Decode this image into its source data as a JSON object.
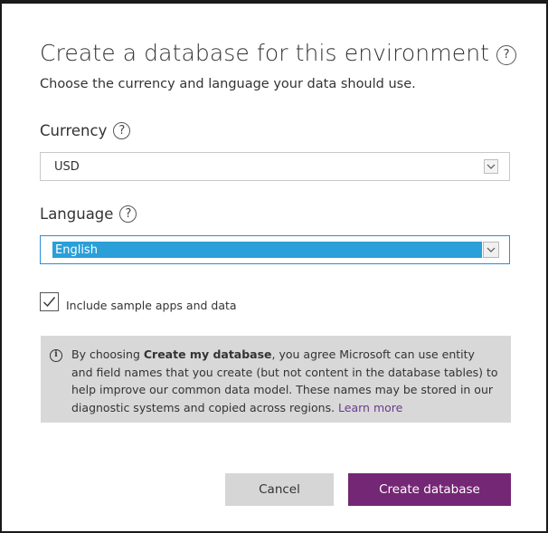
{
  "dialog": {
    "title": "Create a database for this environment",
    "subtitle": "Choose the currency and language your data should use.",
    "help_glyph": "?"
  },
  "currency": {
    "label": "Currency",
    "selected": "USD",
    "icon": "chevron-down-icon"
  },
  "language": {
    "label": "Language",
    "selected": "English",
    "icon": "chevron-down-icon",
    "highlight_color": "#2a9fd8"
  },
  "sample": {
    "label": "Include sample apps and data",
    "checked": true
  },
  "info": {
    "icon": "info-icon",
    "text_before": "By choosing ",
    "bold": "Create my database",
    "text_after": ", you agree Microsoft can use entity and field names that you create (but not content in the database tables) to help improve our common data model. These names may be stored in our diagnostic systems and copied across regions. ",
    "link": "Learn more"
  },
  "buttons": {
    "cancel": "Cancel",
    "create": "Create database",
    "create_color": "#742774"
  }
}
